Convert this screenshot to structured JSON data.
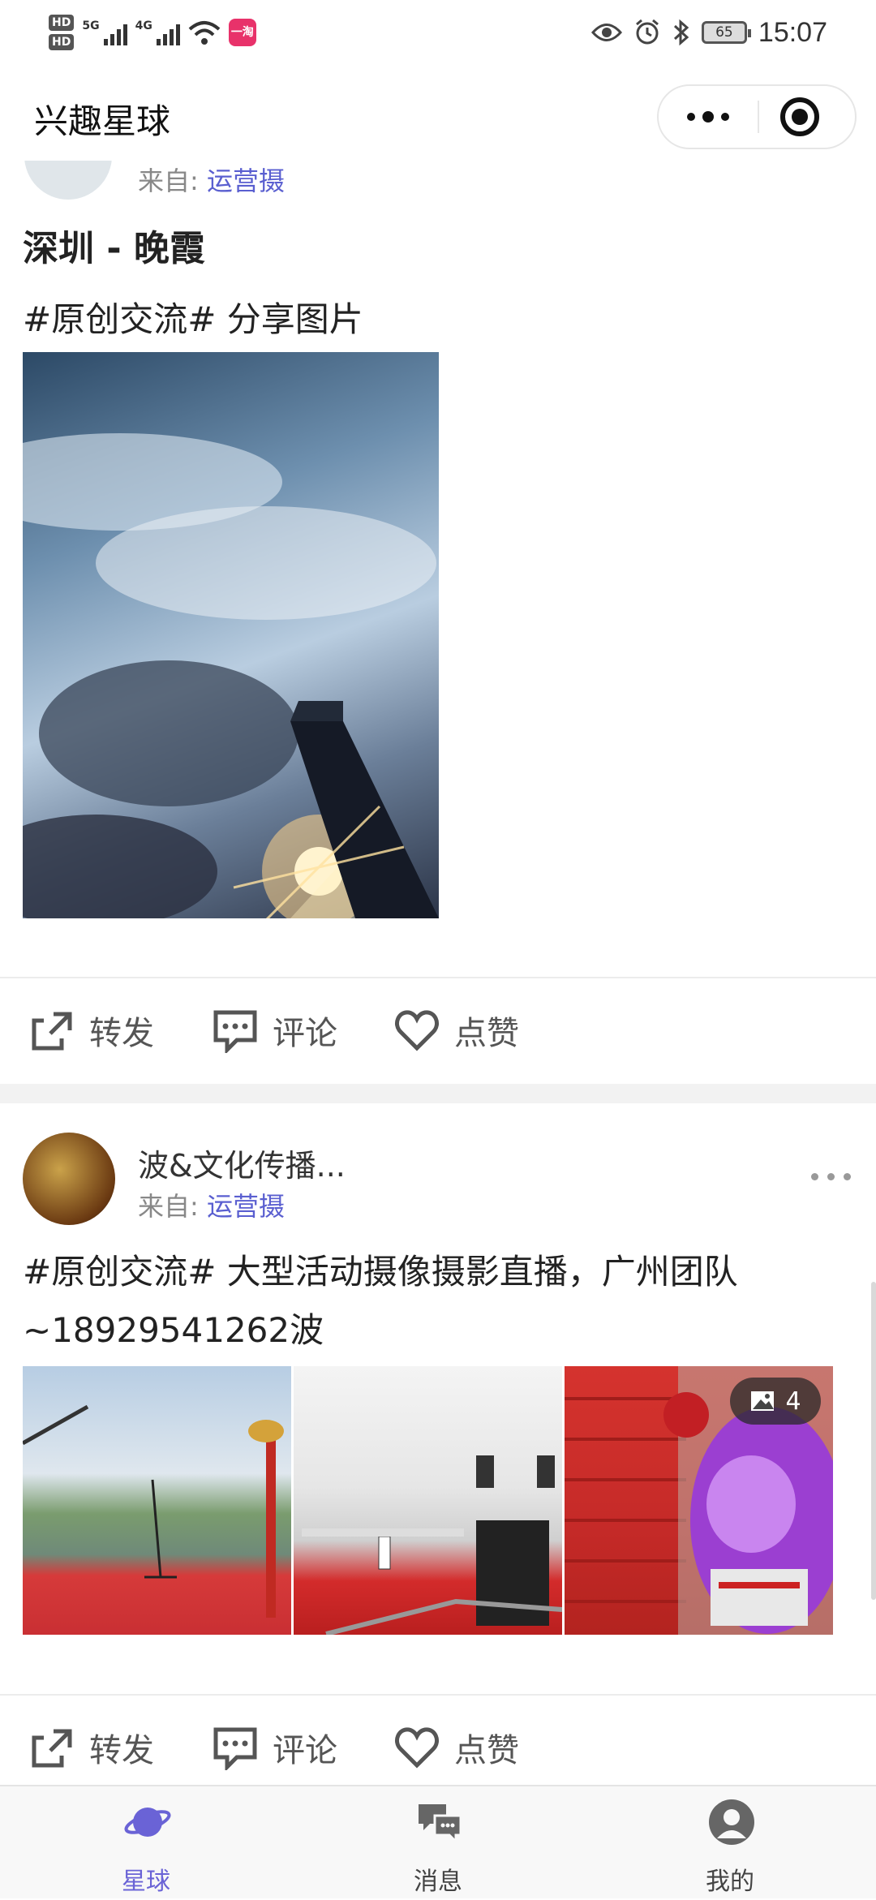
{
  "status_bar": {
    "hd1": "HD",
    "hd2": "HD",
    "sig1_label": "5G",
    "sig2_label": "4G",
    "app_badge": "一淘",
    "battery": "65",
    "time": "15:07"
  },
  "header": {
    "title": "兴趣星球"
  },
  "post1": {
    "source_prefix": "来自:",
    "source_name": "运营摄",
    "title": "深圳 - 晚霞",
    "text": "#原创交流# 分享图片"
  },
  "post2": {
    "username": "波&文化传播...",
    "source_prefix": "来自:",
    "source_name": "运营摄",
    "text": "#原创交流# 大型活动摄像摄影直播，广州团队~18929541262波",
    "image_count": "4"
  },
  "actions": {
    "share": "转发",
    "comment": "评论",
    "like": "点赞"
  },
  "tabbar": {
    "items": [
      {
        "label": "星球",
        "icon": "planet-icon",
        "active": true
      },
      {
        "label": "消息",
        "icon": "chat-bubbles-icon",
        "active": false
      },
      {
        "label": "我的",
        "icon": "user-icon",
        "active": false
      }
    ]
  },
  "colors": {
    "accent": "#6a63d6",
    "link": "#5a5fd0"
  }
}
